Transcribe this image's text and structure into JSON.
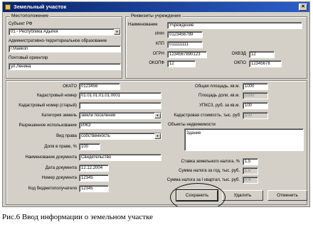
{
  "window": {
    "title": "Земельный участок",
    "close_glyph": "✕"
  },
  "location": {
    "group_title": "Местоположение",
    "subject_label": "Субъект РФ",
    "subject_value": "01 - Республика Адыгея",
    "ato_label": "Административно-территориальное образование",
    "ato_value": "г.Майкоп",
    "address_label": "Почтовый ориентир",
    "address_value": "ул.Ленина"
  },
  "org": {
    "group_title": "Реквизиты учреждения",
    "name_label": "Наименование",
    "name_value": "Учреждение",
    "inn_label": "ИНН",
    "inn_value": "0123456789",
    "kpp_label": "КПП",
    "kpp_value": "011111111",
    "ogrn_label": "ОГРН",
    "ogrn_value": "123456789012З",
    "okved_label": "ОКВЭД",
    "okved_value": "12",
    "okopf_label": "ОКОПФ",
    "okopf_value": "12",
    "okpo_label": "ОКПО",
    "okpo_value": "12345678"
  },
  "land": {
    "okato_label": "ОКАТО",
    "okato_value": "0123456",
    "cadastral_label": "Кадастровый номер",
    "cadastral_value": "01.01.01.01.01.0001",
    "cadastral_old_label": "Кадастровый номер (старый)",
    "cadastral_old_value": "",
    "category_label": "Категория земель",
    "category_value": "земли поселений",
    "use_label": "Разрешенное использование",
    "use_value": "ИЖЗ",
    "right_label": "Вид права",
    "right_value": "собственность",
    "share_label": "Доля в праве, %",
    "share_value": "100",
    "docname_label": "Наименование документа",
    "docname_value": "Свидетельство",
    "docdate_label": "Дата документа",
    "docdate_value": "12.12.2004",
    "docnum_label": "Номер документа",
    "docnum_value": "12345",
    "budget_label": "Код бюджетополучателя",
    "budget_value": "12345"
  },
  "area": {
    "total_label": "Общая площадь, кв.м.",
    "total_value": "1000",
    "sharearea_label": "Площадь доли, кв.м.",
    "sharearea_value": "1000",
    "upksz_label": "УПКСЗ, руб. за кв.м.",
    "upksz_value": "100",
    "cadvalue_label": "Кадастровая стоимость, тыс. руб",
    "cadvalue_value": "100",
    "objects_label": "Объекты недвижимости",
    "objects_value": "Здание",
    "taxrate_label": "Ставка земельного налога, %",
    "taxrate_value": "1,5",
    "taxyear_label": "Сумма налога за год, тыс. руб.",
    "taxyear_value": "1,5",
    "taxq_label": "Сумма налога за I квартал, тыс. руб.",
    "taxq_value": "0,4"
  },
  "buttons": {
    "save": "Сохранить",
    "delete": "Удалить",
    "cancel": "Отменить"
  },
  "caption": "Рис.6 Ввод информации о земельном участке"
}
